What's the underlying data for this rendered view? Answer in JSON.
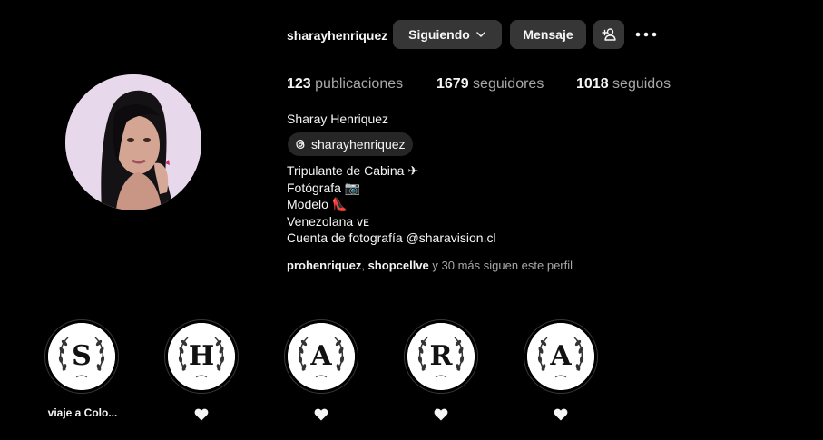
{
  "profile": {
    "username": "sharayhenriquez",
    "follow_label": "Siguiendo",
    "message_label": "Mensaje",
    "stats": {
      "posts_count": "123",
      "posts_label": "publicaciones",
      "followers_count": "1679",
      "followers_label": "seguidores",
      "following_count": "1018",
      "following_label": "seguidos"
    },
    "full_name": "Sharay Henriquez",
    "threads_handle": "sharayhenriquez",
    "bio": [
      "Tripulante de Cabina ✈",
      "Fotógrafa 📷",
      "Modelo 👠",
      "Venezolana ᴠᴇ",
      "Cuenta de fotografía @sharavision.cl"
    ],
    "followed_by": {
      "user1": "prohenriquez",
      "separator": ", ",
      "user2": "shopcellve",
      "rest": " y 30 más siguen este perfil"
    }
  },
  "highlights": [
    {
      "letter": "S",
      "label": "viaje a Colo...",
      "icon": "heart-icon"
    },
    {
      "letter": "H",
      "label": "",
      "icon": "heart-icon"
    },
    {
      "letter": "A",
      "label": "",
      "icon": "heart-icon"
    },
    {
      "letter": "R",
      "label": "",
      "icon": "heart-icon"
    },
    {
      "letter": "A",
      "label": "",
      "icon": "heart-icon"
    }
  ],
  "colors": {
    "background": "#000000",
    "button": "#363636",
    "secondary_text": "#a8a8a8"
  }
}
